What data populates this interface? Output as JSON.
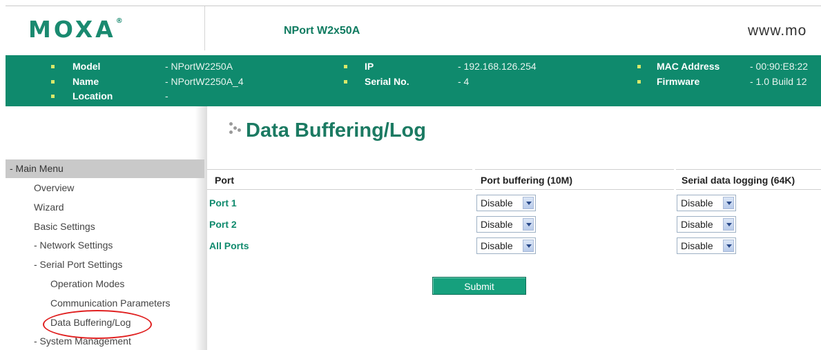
{
  "header": {
    "logo_text": "MOXA",
    "logo_reg": "®",
    "product_name": "NPort W2x50A",
    "website": "www.mo"
  },
  "info": {
    "model_label": "Model",
    "model_value": "- NPortW2250A",
    "name_label": "Name",
    "name_value": "- NPortW2250A_4",
    "location_label": "Location",
    "location_value": "-",
    "ip_label": "IP",
    "ip_value": "- 192.168.126.254",
    "serial_label": "Serial No.",
    "serial_value": "- 4",
    "mac_label": "MAC Address",
    "mac_value": "- 00:90:E8:22",
    "firmware_label": "Firmware",
    "firmware_value": "- 1.0 Build 12"
  },
  "nav": {
    "main_menu": "- Main Menu",
    "items": [
      "Overview",
      "Wizard",
      "Basic Settings",
      "- Network Settings",
      "- Serial Port Settings",
      "Operation Modes",
      "Communication Parameters",
      "Data Buffering/Log",
      "- System Management"
    ]
  },
  "main": {
    "title": "Data Buffering/Log",
    "columns": [
      "Port",
      "Port buffering (10M)",
      "Serial data logging (64K)"
    ],
    "rows": [
      {
        "port": "Port 1",
        "buffering": "Disable",
        "logging": "Disable"
      },
      {
        "port": "Port 2",
        "buffering": "Disable",
        "logging": "Disable"
      },
      {
        "port": "All Ports",
        "buffering": "Disable",
        "logging": "Disable"
      }
    ],
    "submit_label": "Submit"
  },
  "colors": {
    "brand_green": "#0f8a6d",
    "highlight": "#e02020"
  }
}
